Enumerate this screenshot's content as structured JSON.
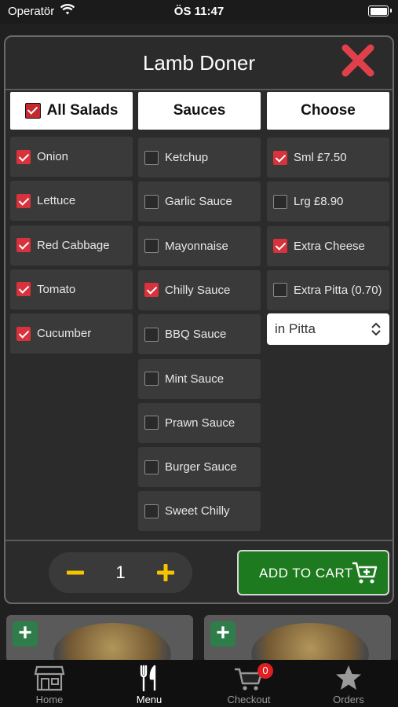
{
  "status_bar": {
    "carrier": "Operatör",
    "time": "ÖS 11:47"
  },
  "modal": {
    "title": "Lamb Doner",
    "salads": {
      "header": "All Salads",
      "header_checked": true,
      "items": [
        {
          "label": "Onion",
          "checked": true
        },
        {
          "label": "Lettuce",
          "checked": true
        },
        {
          "label": "Red Cabbage",
          "checked": true
        },
        {
          "label": "Tomato",
          "checked": true
        },
        {
          "label": "Cucumber",
          "checked": true
        }
      ]
    },
    "sauces": {
      "header": "Sauces",
      "items": [
        {
          "label": "Ketchup",
          "checked": false
        },
        {
          "label": "Garlic Sauce",
          "checked": false
        },
        {
          "label": "Mayonnaise",
          "checked": false
        },
        {
          "label": "Chilly Sauce",
          "checked": true
        },
        {
          "label": "BBQ Sauce",
          "checked": false
        },
        {
          "label": "Mint Sauce",
          "checked": false
        },
        {
          "label": "Prawn Sauce",
          "checked": false
        },
        {
          "label": "Burger Sauce",
          "checked": false
        },
        {
          "label": "Sweet Chilly",
          "checked": false
        }
      ]
    },
    "choose": {
      "header": "Choose",
      "items": [
        {
          "label": "Sml £7.50",
          "checked": true
        },
        {
          "label": "Lrg £8.90",
          "checked": false
        },
        {
          "label": "Extra Cheese",
          "checked": true
        },
        {
          "label": "Extra Pitta (0.70)",
          "checked": false
        }
      ],
      "select_value": "in Pitta"
    },
    "quantity": "1",
    "add_to_cart_label": "ADD TO CART"
  },
  "tabbar": {
    "items": [
      {
        "label": "Home",
        "icon": "store-icon"
      },
      {
        "label": "Menu",
        "icon": "fork-knife-icon"
      },
      {
        "label": "Checkout",
        "icon": "cart-icon",
        "badge": "0"
      },
      {
        "label": "Orders",
        "icon": "star-icon"
      }
    ],
    "active": "Menu"
  },
  "colors": {
    "checked": "#d8323c",
    "close": "#e0404a",
    "cart_button": "#1e7a1e",
    "stepper_icons": "#f5c400",
    "badge": "#e02020"
  }
}
